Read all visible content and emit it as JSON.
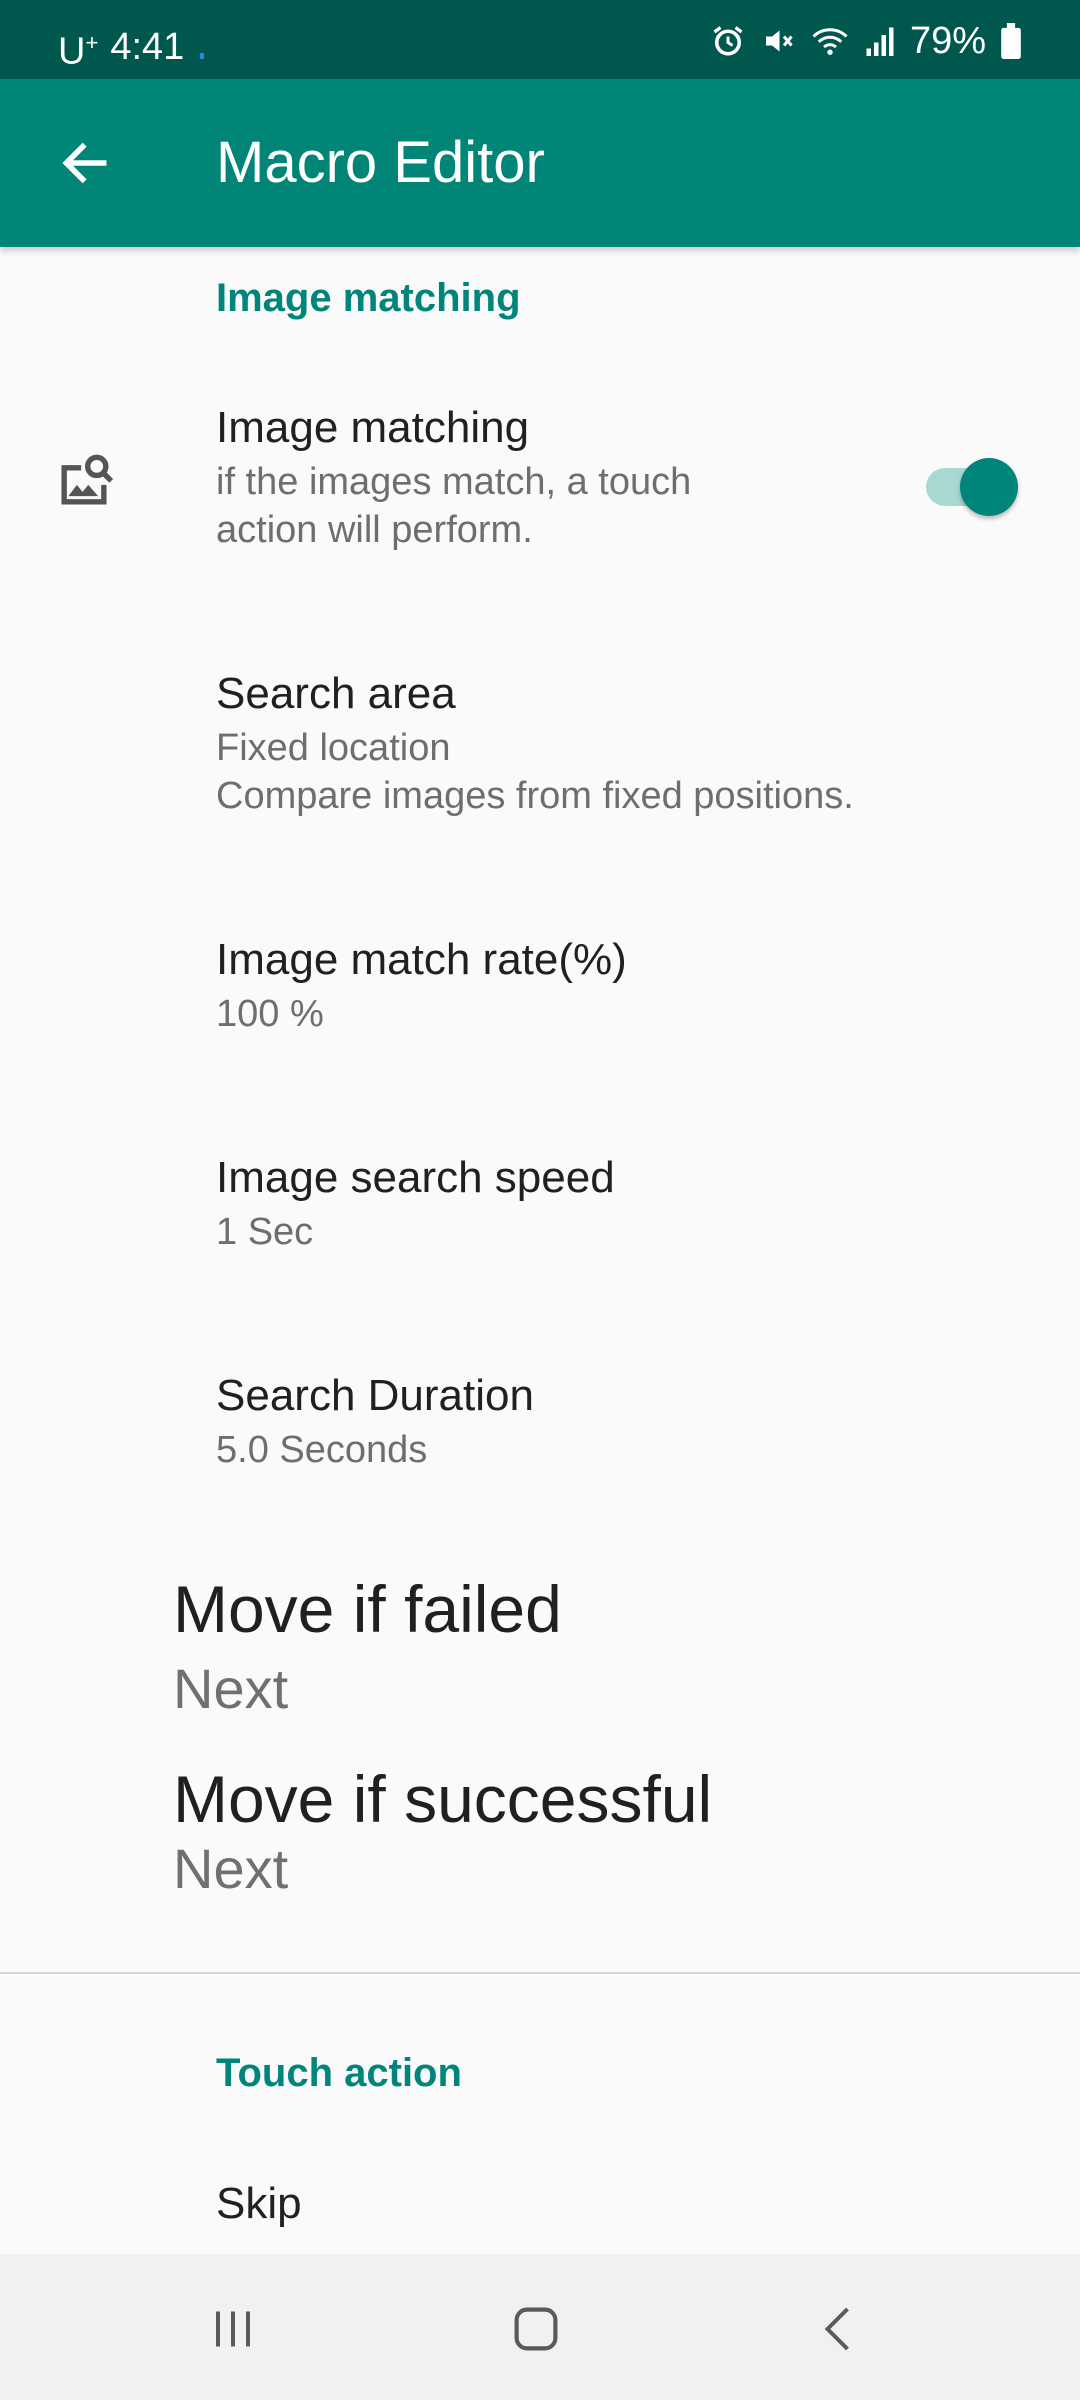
{
  "status_bar": {
    "carrier": "U",
    "carrier_sup": "+",
    "time": "4:41",
    "battery": "79%",
    "icons": [
      "alarm-icon",
      "mute-icon",
      "wifi-icon",
      "signal-icon",
      "battery-icon"
    ]
  },
  "app_bar": {
    "title": "Macro Editor",
    "back_icon": "back-arrow-icon"
  },
  "image_matching_section": {
    "header": "Image matching",
    "toggle_pref": {
      "title": "Image matching",
      "summary_line1": "if the images match, a touch",
      "summary_line2": "action will perform.",
      "icon": "image-search-icon",
      "enabled": true
    },
    "search_area": {
      "title": "Search area",
      "summary_line1": "Fixed location",
      "summary_line2": "Compare images from fixed positions."
    },
    "match_rate": {
      "title": "Image match rate(%)",
      "summary": "100 %"
    },
    "search_speed": {
      "title": "Image search speed",
      "summary": "1 Sec"
    },
    "search_duration": {
      "title": "Search Duration",
      "summary": "5.0 Seconds"
    },
    "move_if_failed": {
      "title": "Move if failed",
      "value": "Next"
    },
    "move_if_successful": {
      "title": "Move if successful",
      "value": "Next"
    }
  },
  "touch_action_section": {
    "header": "Touch action",
    "skip": {
      "title": "Skip"
    }
  },
  "colors": {
    "status_bar": "#00574d",
    "app_bar": "#008577",
    "accent": "#00857a"
  },
  "nav_bar": {
    "icons": [
      "recent-apps-icon",
      "home-icon",
      "back-icon"
    ]
  }
}
